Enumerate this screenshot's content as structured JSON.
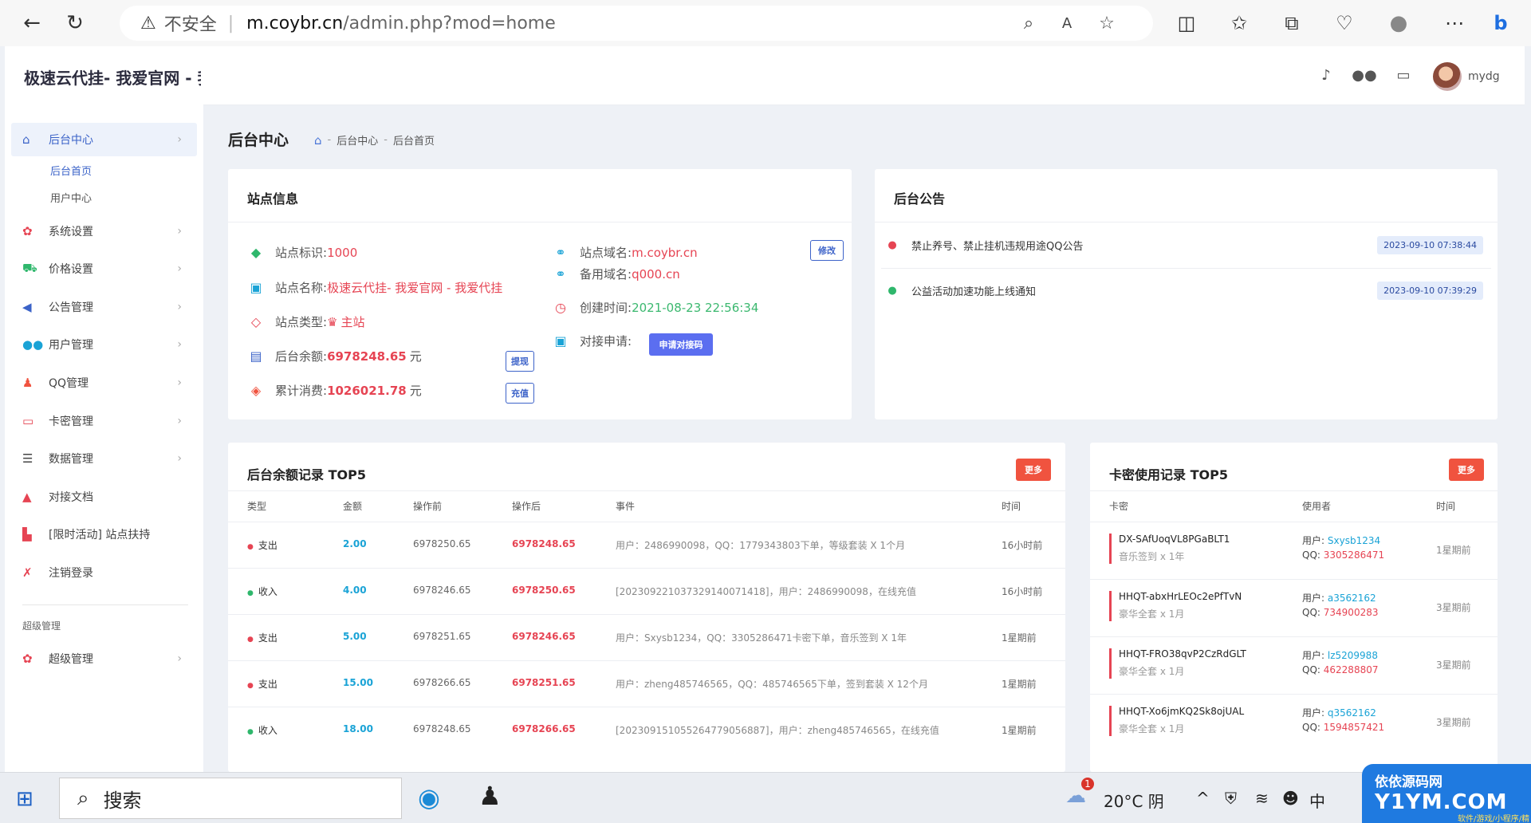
{
  "browser": {
    "insecure_label": "不安全",
    "url_host": "m.coybr.cn",
    "url_path": "/admin.php?mod=home",
    "separator": "|"
  },
  "sidebar": {
    "brand": "极速云代挂- 我爱官网 - 我",
    "items": [
      {
        "label": "后台中心",
        "icon": "store-icon",
        "active": true
      },
      {
        "label": "系统设置",
        "icon": "gear-icon"
      },
      {
        "label": "价格设置",
        "icon": "cart-icon"
      },
      {
        "label": "公告管理",
        "icon": "megaphone-icon"
      },
      {
        "label": "用户管理",
        "icon": "users-icon"
      },
      {
        "label": "QQ管理",
        "icon": "qq-icon"
      },
      {
        "label": "卡密管理",
        "icon": "card-icon"
      },
      {
        "label": "数据管理",
        "icon": "list-icon"
      },
      {
        "label": "对接文档",
        "icon": "graduation-icon"
      },
      {
        "label": "[限时活动] 站点扶持",
        "icon": "factory-icon"
      },
      {
        "label": "注销登录",
        "icon": "runner-icon"
      }
    ],
    "sub_items": [
      "后台首页",
      "用户中心"
    ],
    "section": "超级管理",
    "super_item": "超级管理"
  },
  "topbar": {
    "username": "mydg"
  },
  "page": {
    "title": "后台中心",
    "breadcrumb": [
      "后台中心",
      "后台首页"
    ]
  },
  "site_info": {
    "title": "站点信息",
    "id_label": "站点标识:",
    "id_value": "1000",
    "name_label": "站点名称:",
    "name_value": "极速云代挂- 我爱官网 - 我爱代挂",
    "type_label": "站点类型:",
    "type_value": "主站",
    "balance_label": "后台余额:",
    "balance_value": "6978248.65",
    "balance_unit": "元",
    "spent_label": "累计消费:",
    "spent_value": "1026021.78",
    "spent_unit": "元",
    "domain_label": "站点域名:",
    "domain_value": "m.coybr.cn",
    "backup_label": "备用域名:",
    "backup_value": "q000.cn",
    "created_label": "创建时间:",
    "created_value": "2021-08-23 22:56:34",
    "dock_label": "对接申请:",
    "btn_edit": "修改",
    "btn_withdraw": "提现",
    "btn_recharge": "充值",
    "btn_apply": "申请对接码"
  },
  "announcements": {
    "title": "后台公告",
    "items": [
      {
        "text": "禁止养号、禁止挂机违规用途QQ公告",
        "date": "2023-09-10 07:38:44",
        "color": "#e64453"
      },
      {
        "text": "公益活动加速功能上线通知",
        "date": "2023-09-10 07:39:29",
        "color": "#2fb76c"
      }
    ]
  },
  "balance_log": {
    "title": "后台余额记录 TOP5",
    "more": "更多",
    "headers": [
      "类型",
      "金额",
      "操作前",
      "操作后",
      "事件",
      "时间"
    ],
    "rows": [
      {
        "type": "支出",
        "amount": "2.00",
        "before": "6978250.65",
        "after": "6978248.65",
        "event": "用户：2486990098，QQ：1779343803下单，等级套装 X 1个月",
        "time": "16小时前"
      },
      {
        "type": "收入",
        "amount": "4.00",
        "before": "6978246.65",
        "after": "6978250.65",
        "event": "[2023092210373291400714​18]，用户：2486990098，在线充值",
        "time": "16小时前"
      },
      {
        "type": "支出",
        "amount": "5.00",
        "before": "6978251.65",
        "after": "6978246.65",
        "event": "用户：Sxysb1234，QQ：3305286471卡密下单，音乐签到 X 1年",
        "time": "1星期前"
      },
      {
        "type": "支出",
        "amount": "15.00",
        "before": "6978266.65",
        "after": "6978251.65",
        "event": "用户：zheng485746565，QQ：485746565下单，签到套装 X 12个月",
        "time": "1星期前"
      },
      {
        "type": "收入",
        "amount": "18.00",
        "before": "6978248.65",
        "after": "6978266.65",
        "event": "[20230915105526477905688​7]，用户：zheng485746565，在线充值",
        "time": "1星期前"
      }
    ]
  },
  "card_log": {
    "title": "卡密使用记录 TOP5",
    "more": "更多",
    "headers": [
      "卡密",
      "使用者",
      "时间"
    ],
    "user_label": "用户:",
    "qq_label": "QQ:",
    "rows": [
      {
        "code": "DX-SAfUoqVL8PGaBLT1",
        "pkg": "音乐签到 x 1年",
        "user": "Sxysb1234",
        "qq": "3305286471",
        "time": "1星期前"
      },
      {
        "code": "HHQT-abxHrLEOc2ePfTvN",
        "pkg": "豪华全套 x 1月",
        "user": "a3562162",
        "qq": "734900283",
        "time": "3星期前"
      },
      {
        "code": "HHQT-FRO38qvP2CzRdGLT",
        "pkg": "豪华全套 x 1月",
        "user": "lz5209988",
        "qq": "462288807",
        "time": "3星期前"
      },
      {
        "code": "HHQT-Xo6jmKQ2Sk8ojUAL",
        "pkg": "豪华全套 x 1月",
        "user": "q3562162",
        "qq": "1594857421",
        "time": "3星期前"
      }
    ]
  },
  "taskbar": {
    "search": "搜索",
    "weather": "20°C 阴",
    "ime": "中",
    "notify_count": "1"
  },
  "watermark": {
    "line1": "依依源码网",
    "line2": "Y1YM.COM",
    "line3": "软件/游戏/小程序/精品"
  }
}
